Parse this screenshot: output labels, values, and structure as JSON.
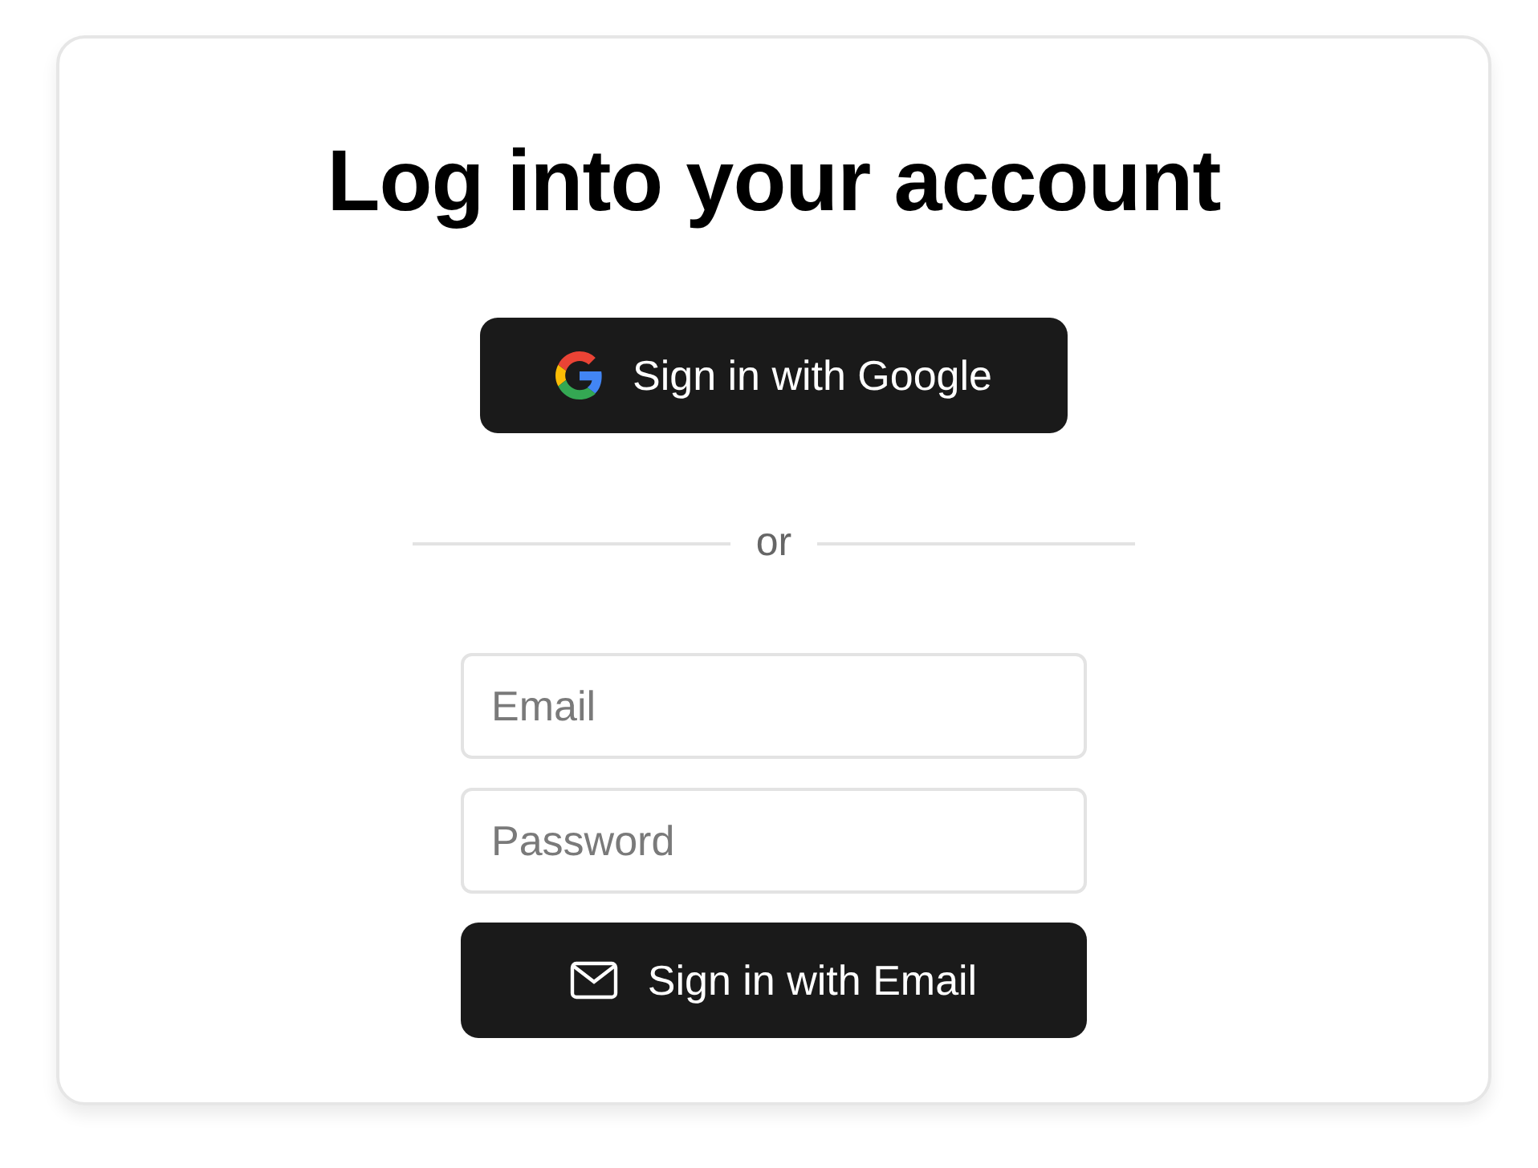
{
  "title": "Log into your account",
  "google_button": {
    "label": "Sign in with Google"
  },
  "divider": {
    "label": "or"
  },
  "fields": [
    {
      "placeholder": "Email"
    },
    {
      "placeholder": "Password"
    }
  ],
  "email_button": {
    "label": "Sign in with Email"
  }
}
